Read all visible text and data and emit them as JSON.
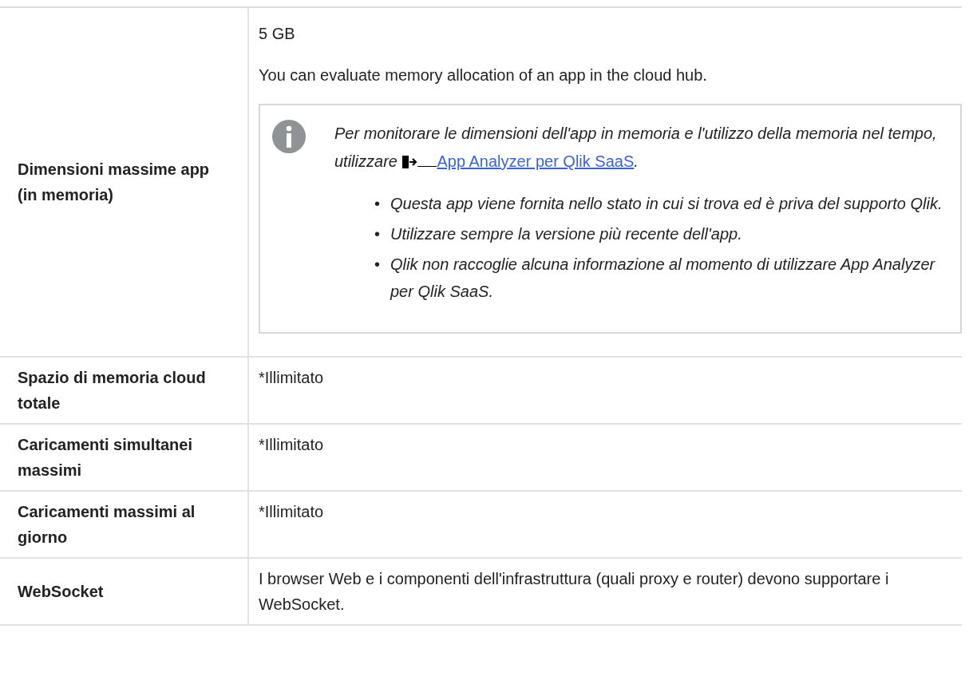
{
  "rows": [
    {
      "label": "Dimensioni massime app (in memoria)",
      "blocks": [
        {
          "kind": "text",
          "text": "5 GB"
        },
        {
          "kind": "text",
          "text": "You can evaluate memory allocation of an app in the cloud hub."
        },
        {
          "kind": "note",
          "text": "Per monitorare le dimensioni dell'app in memoria e l'utilizzo della memoria nel tempo, utilizzare",
          "link": "App Analyzer per Qlik SaaS",
          "after": ".",
          "marker": "•",
          "bullets": [
            "Questa app viene fornita nello stato in cui si trova ed è priva del supporto Qlik.",
            "Utilizzare sempre la versione più recente dell'app.",
            "Qlik non raccoglie alcuna informazione al momento di utilizzare App Analyzer per Qlik SaaS."
          ]
        }
      ]
    },
    {
      "label": "Spazio di memoria cloud totale",
      "blocks": [
        {
          "kind": "text",
          "text": "*Illimitato"
        }
      ]
    },
    {
      "label": "Caricamenti simultanei massimi",
      "blocks": [
        {
          "kind": "text",
          "text": "*Illimitato"
        }
      ]
    },
    {
      "label": "Caricamenti massimi al giorno",
      "blocks": [
        {
          "kind": "text",
          "text": "*Illimitato"
        }
      ]
    },
    {
      "label": "WebSocket",
      "blocks": [
        {
          "kind": "text",
          "text": "I browser Web e i componenti dell'infrastruttura (quali proxy e router) devono supportare i WebSocket."
        }
      ]
    }
  ]
}
